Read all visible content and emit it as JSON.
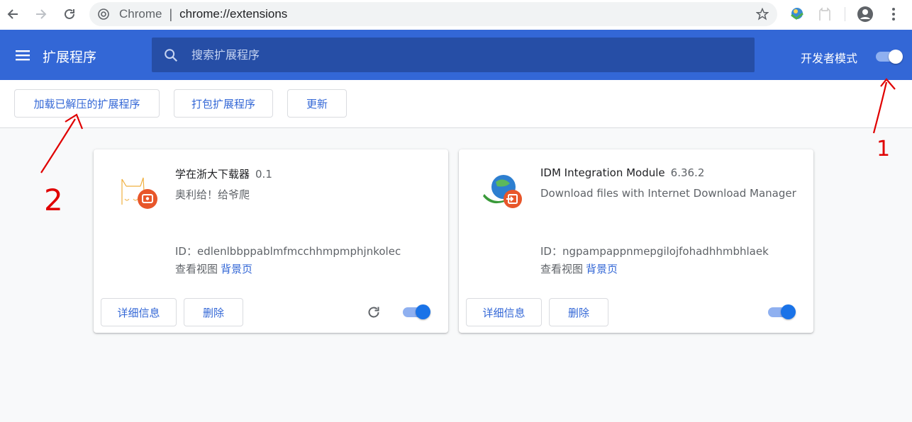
{
  "browser": {
    "omnibox_site": "Chrome",
    "omnibox_sep": "|",
    "omnibox_url": "chrome://extensions"
  },
  "header": {
    "title": "扩展程序",
    "search_placeholder": "搜索扩展程序",
    "dev_mode_label": "开发者模式",
    "dev_mode_on": true
  },
  "actions": {
    "load_unpacked": "加载已解压的扩展程序",
    "pack": "打包扩展程序",
    "update": "更新"
  },
  "extensions": [
    {
      "name": "学在浙大下载器",
      "version": "0.1",
      "description": "奥利给！给爷爬",
      "id_line": "ID：edlenlbbppablmfmcchhmpmphjnkolec",
      "views_label": "查看视图",
      "views_link": "背景页",
      "details_label": "详细信息",
      "remove_label": "删除",
      "enabled": true
    },
    {
      "name": "IDM Integration Module",
      "version": "6.36.2",
      "description": "Download files with Internet Download Manager",
      "id_line": "ID：ngpampappnmepgilojfohadhhmbhlaek",
      "views_label": "查看视图",
      "views_link": "背景页",
      "details_label": "详细信息",
      "remove_label": "删除",
      "enabled": true
    }
  ],
  "annotations": {
    "mark_1": "1",
    "mark_2": "2"
  },
  "colors": {
    "header_blue": "#3367d6",
    "search_blue": "#264ea6",
    "toggle_blue": "#1a73e8",
    "annotation_red": "#e00000"
  }
}
